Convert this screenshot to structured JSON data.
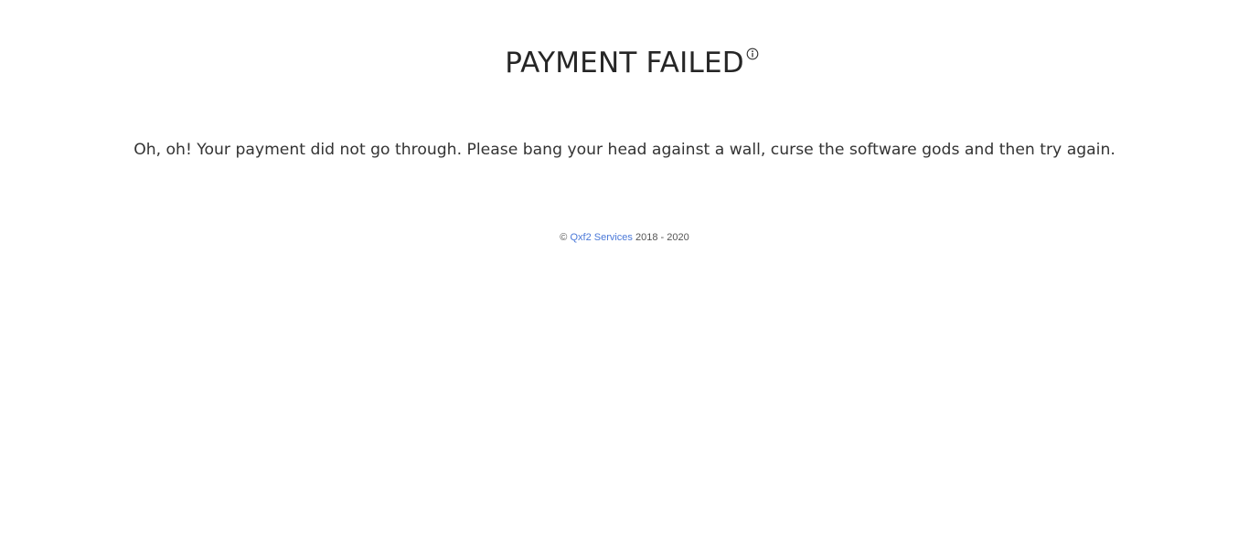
{
  "header": {
    "title": "PAYMENT FAILED",
    "info_icon": "info-circle-icon"
  },
  "main": {
    "message": "Oh, oh! Your payment did not go through. Please bang your head against a wall, curse the software gods and then try again."
  },
  "footer": {
    "copyright_symbol": "©",
    "link_text": "Qxf2 Services",
    "years": "2018 - 2020",
    "link_color": "#4a78d8"
  }
}
